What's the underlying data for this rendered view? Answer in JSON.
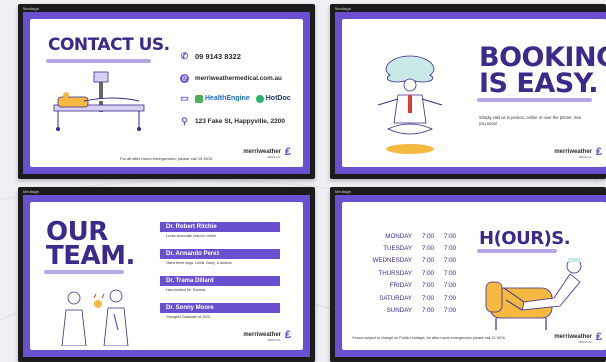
{
  "brand_tag": "Medisign",
  "contact": {
    "title": "CONTACT US.",
    "phone": "09 9143 8322",
    "website": "merriweathermedical.com.au",
    "partners": [
      "HealthEngine",
      "HotDoc"
    ],
    "address": "123 Fake St, Happyville, 2200",
    "footnote": "For all after-hours emergencies, please call 13 SICK."
  },
  "booking": {
    "title_line1": "BOOKING",
    "title_line2": "IS EASY.",
    "text": "Simply visit us in person, online or over the phone. See you soon!"
  },
  "team": {
    "title_line1": "OUR",
    "title_line2": "TEAM.",
    "doctors": [
      {
        "name": "Dr. Robert Ritchie",
        "desc": "Loves chocolate chip ice cream."
      },
      {
        "name": "Dr. Armando Perez",
        "desc": "Owns three dogs, Lewis, Barry, & Andrea."
      },
      {
        "name": "Dr. Trama Dillard",
        "desc": "Has climbed Mt. Everest."
      },
      {
        "name": "Dr. Sonny Moore",
        "desc": "Youngest Graduate of 2020."
      }
    ]
  },
  "hours": {
    "title": "H(OUR)S.",
    "days": [
      {
        "day": "MONDAY",
        "open": "7:00",
        "close": "7:00"
      },
      {
        "day": "TUESDAY",
        "open": "7:00",
        "close": "7:00"
      },
      {
        "day": "WEDNESDAY",
        "open": "7:00",
        "close": "7:00"
      },
      {
        "day": "THURSDAY",
        "open": "7:00",
        "close": "7:00"
      },
      {
        "day": "FRIDAY",
        "open": "7:00",
        "close": "7:00"
      },
      {
        "day": "SATURDAY",
        "open": "7:00",
        "close": "7:00"
      },
      {
        "day": "SUNDAY",
        "open": "7:00",
        "close": "7:00"
      }
    ],
    "footnote": "*Hours subject to change on Public Holidays, for after-hours emergencies please call 13 SICK."
  },
  "logo": {
    "name": "merriweather",
    "sub": "MEDICAL"
  },
  "colors": {
    "accent": "#6a4fd0",
    "heading": "#3b2a8c",
    "highlight": "#b7a6e6",
    "illustration": "#f5b942"
  }
}
